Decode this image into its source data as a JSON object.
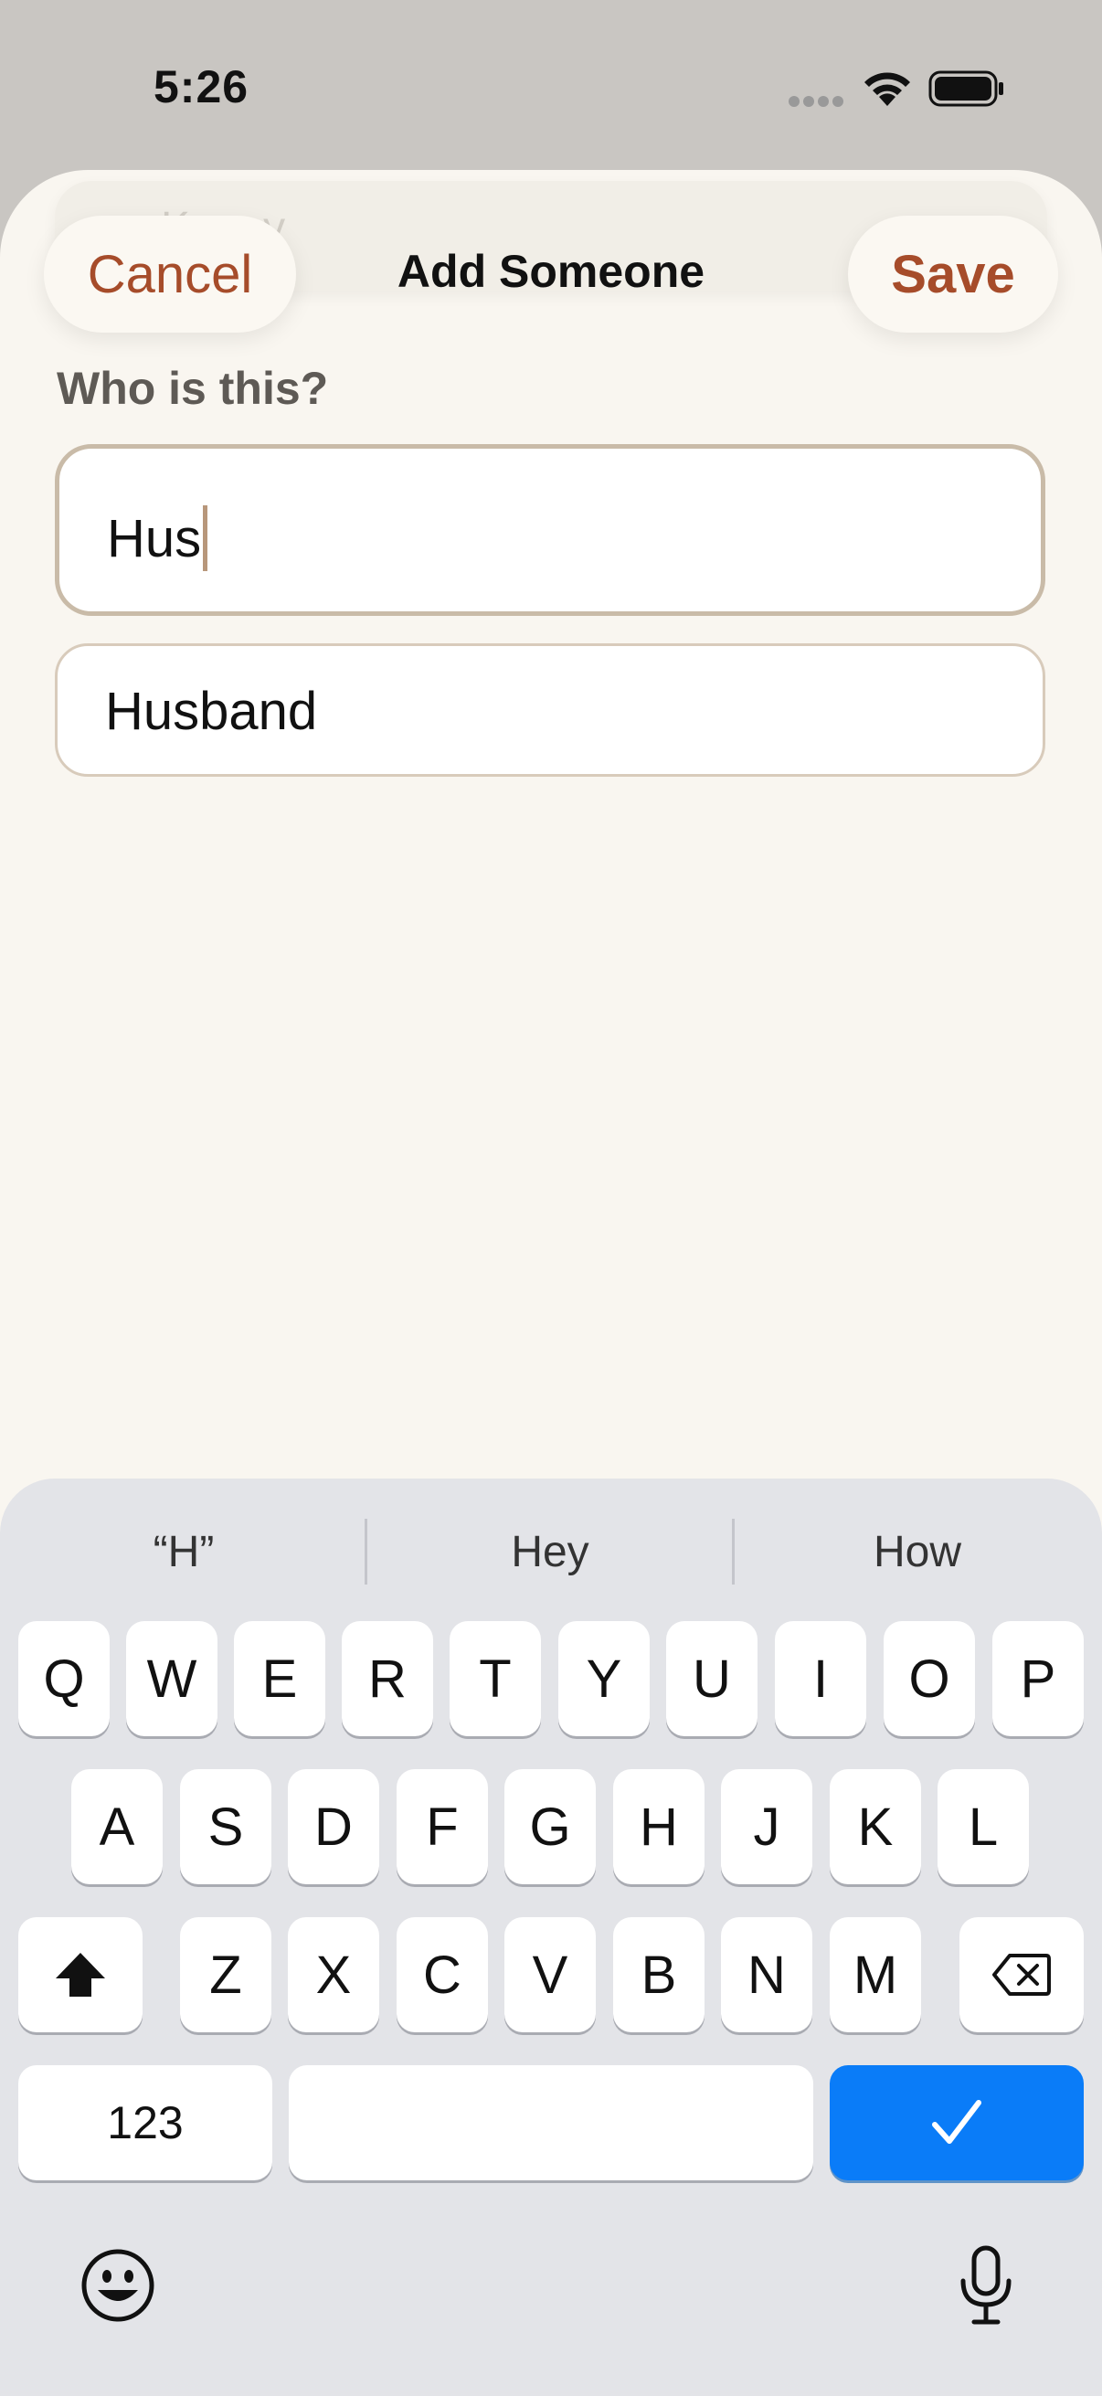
{
  "status_bar": {
    "time": "5:26"
  },
  "sheet": {
    "ghost_text": "Kenny",
    "cancel_label": "Cancel",
    "title": "Add Someone",
    "save_label": "Save",
    "field_label": "Who is this?",
    "field_value": "Hus",
    "suggestion": "Husband"
  },
  "keyboard": {
    "predictions": [
      "“H”",
      "Hey",
      "How"
    ],
    "row1": [
      "Q",
      "W",
      "E",
      "R",
      "T",
      "Y",
      "U",
      "I",
      "O",
      "P"
    ],
    "row2": [
      "A",
      "S",
      "D",
      "F",
      "G",
      "H",
      "J",
      "K",
      "L"
    ],
    "row3": [
      "Z",
      "X",
      "C",
      "V",
      "B",
      "N",
      "M"
    ],
    "numbers_label": "123",
    "shift_icon": "shift-icon",
    "delete_icon": "delete-backward-icon",
    "done_icon": "checkmark-icon",
    "emoji_icon": "emoji-icon",
    "mic_icon": "microphone-icon"
  },
  "colors": {
    "accent": "#a64c2a",
    "sheet_bg": "#f9f6f0",
    "keyboard_bg": "#e3e4e8",
    "done_key": "#0a7cf8",
    "field_border": "#c9bba8"
  }
}
